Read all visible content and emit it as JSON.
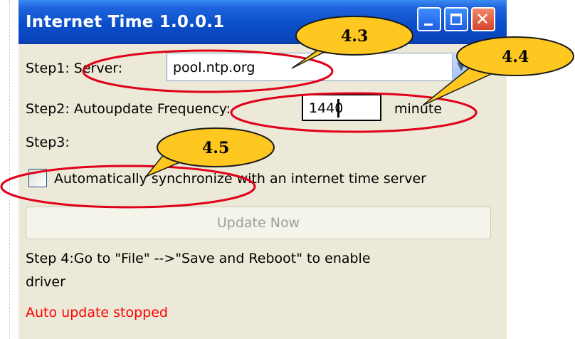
{
  "window": {
    "title": "Internet Time 1.0.0.1",
    "close_glyph": "✕"
  },
  "step1": {
    "label": "Step1: Server:",
    "server_value": "pool.ntp.org",
    "dropdown_glyph": "▼"
  },
  "step2": {
    "label": "Step2: Autoupdate Frequency:",
    "frequency_value": "1440",
    "unit": "minute"
  },
  "step3": {
    "label": "Step3:",
    "checkbox_label": "Automatically synchronize with an internet time server",
    "checked": false
  },
  "update_button": {
    "label": "Update Now"
  },
  "step4": {
    "line1": "Step 4:Go to \"File\" -->\"Save and Reboot\" to enable",
    "line2": "driver"
  },
  "status": {
    "text": "Auto update stopped",
    "color": "#ff0000"
  },
  "callouts": [
    {
      "label": "4.3"
    },
    {
      "label": "4.4"
    },
    {
      "label": "4.5"
    }
  ],
  "colors": {
    "titlebar": "#0a4ec9",
    "window_bg": "#ece9d8",
    "annotation_ring": "#e0001a",
    "callout_fill": "#ffc820"
  },
  "icons": {
    "minimize": "minimize-icon",
    "maximize": "maximize-icon",
    "close": "close-icon",
    "dropdown": "chevron-down-icon"
  }
}
